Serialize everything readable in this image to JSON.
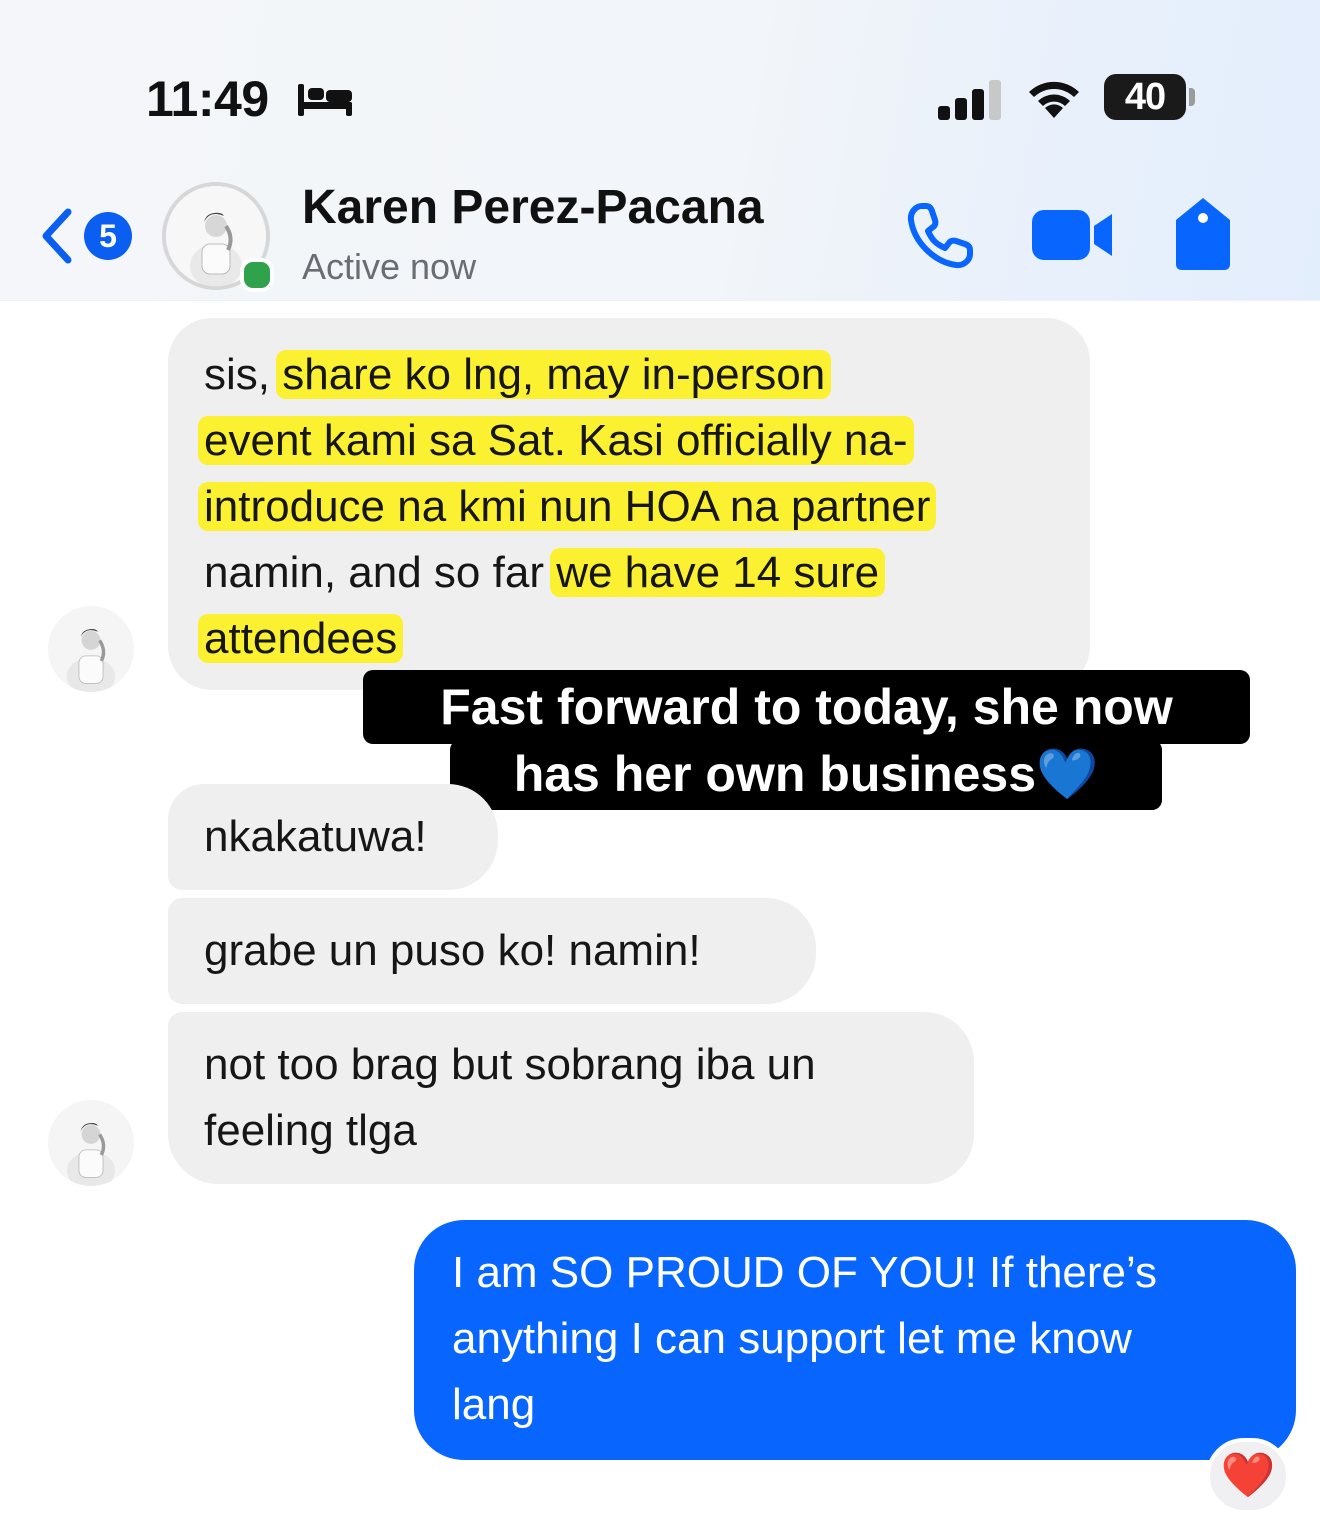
{
  "status_bar": {
    "time": "11:49",
    "battery": "40",
    "icons": [
      "bed-icon",
      "signal-icon",
      "wifi-icon",
      "battery-icon"
    ]
  },
  "header": {
    "back_badge": "5",
    "contact_name": "Karen Perez-Pacana",
    "status": "Active now",
    "icons": [
      "back-chevron-icon",
      "avatar",
      "phone-call-icon",
      "video-call-icon",
      "tag-icon"
    ]
  },
  "messages": {
    "m1": {
      "lines": [
        "sis, ",
        "share ko lng, may in-person",
        "event kami sa Sat. Kasi officially na-",
        "introduce na kmi nun HOA na partner",
        "namin, and so far ",
        "we have 14 sure",
        "attendees"
      ]
    },
    "m2": "nkakatuwa!",
    "m3": "grabe un puso ko! namin!",
    "m4": [
      "not too brag but sobrang iba un",
      "feeling tlga"
    ],
    "out1": [
      "I am SO PROUD OF YOU! If there’s",
      "anything I can support let me know",
      "lang"
    ]
  },
  "caption": {
    "line1": "Fast forward to today, she now",
    "line2": "has her own business💙"
  },
  "reaction": "❤️",
  "colors": {
    "accent": "#0866ff",
    "incoming_bubble": "#efeff0",
    "highlight": "#fff100",
    "online": "#31a24c"
  }
}
